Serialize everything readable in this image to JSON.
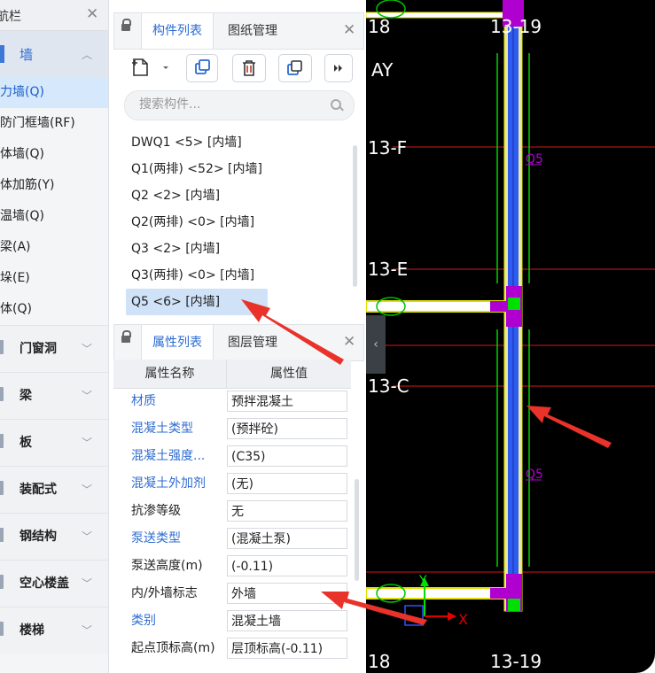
{
  "nav": {
    "title": "航栏",
    "open_category": "墙",
    "items": [
      "力墙(Q)",
      "防门框墙(RF)",
      "体墙(Q)",
      "体加筋(Y)",
      "温墙(Q)",
      "梁(A)",
      "垛(E)",
      "体(Q)"
    ],
    "selected_index": 0,
    "categories": [
      "门窗洞",
      "梁",
      "板",
      "装配式",
      "钢结构",
      "空心楼盖",
      "楼梯"
    ]
  },
  "component_panel": {
    "tabs": [
      "构件列表",
      "图纸管理"
    ],
    "active_tab": 0,
    "search_placeholder": "搜索构件...",
    "items": [
      "DWQ1 <5> [内墙]",
      "Q1(两排) <52> [内墙]",
      "Q2 <2> [内墙]",
      "Q2(两排) <0> [内墙]",
      "Q3 <2> [内墙]",
      "Q3(两排) <0> [内墙]",
      "Q5 <6> [内墙]"
    ],
    "selected_index": 6
  },
  "property_panel": {
    "tabs": [
      "属性列表",
      "图层管理"
    ],
    "active_tab": 0,
    "col_name": "属性名称",
    "col_value": "属性值",
    "rows": [
      {
        "name": "材质",
        "value": "预拌混凝土",
        "blue": true
      },
      {
        "name": "混凝土类型",
        "value": "(预拌砼)",
        "blue": true
      },
      {
        "name": "混凝土强度...",
        "value": "(C35)",
        "blue": true
      },
      {
        "name": "混凝土外加剂",
        "value": "(无)",
        "blue": true
      },
      {
        "name": "抗渗等级",
        "value": "无",
        "blue": false
      },
      {
        "name": "泵送类型",
        "value": "(混凝土泵)",
        "blue": true
      },
      {
        "name": "泵送高度(m)",
        "value": "(-0.11)",
        "blue": false
      },
      {
        "name": "内/外墙标志",
        "value": "外墙",
        "blue": false
      },
      {
        "name": "类别",
        "value": "混凝土墙",
        "blue": true
      },
      {
        "name": "起点顶标高(m)",
        "value": "层顶标高(-0.11)",
        "blue": false
      }
    ]
  },
  "cad": {
    "axis_labels": {
      "top_left": "18",
      "top_right": "13-19",
      "ay": "AY",
      "f": "13-F",
      "e": "13-E",
      "c": "13-C",
      "bottom_left": "18",
      "bottom_right": "13-19"
    },
    "wall_tags": [
      "Q5",
      "Q5"
    ],
    "ucs": {
      "x": "X",
      "y": "Y"
    }
  },
  "colors": {
    "accent": "#2b6ad4",
    "wall_blue": "#2e5cf0",
    "magenta": "#b000d0",
    "axis_red": "#d01818",
    "green": "#00e000",
    "annot_red": "#e8322a"
  }
}
